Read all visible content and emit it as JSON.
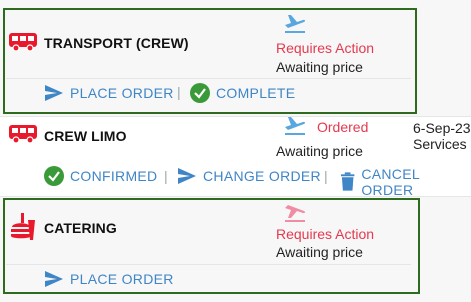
{
  "rows": [
    {
      "label": "TRANSPORT (CREW)",
      "status_primary": "Requires Action",
      "status_secondary": "Awaiting price",
      "actions": [
        "PLACE ORDER",
        "COMPLETE"
      ]
    },
    {
      "label": "CREW LIMO",
      "status_primary": "Ordered",
      "status_secondary": "Awaiting price",
      "date_text": "6-Sep-23",
      "vendor_text": "Services",
      "actions": [
        "CONFIRMED",
        "CHANGE ORDER",
        "CANCEL ORDER"
      ]
    },
    {
      "label": "CATERING",
      "status_primary": "Requires Action",
      "status_secondary": "Awaiting price",
      "actions": [
        "PLACE ORDER"
      ]
    }
  ],
  "separator": "|",
  "colors": {
    "action_blue": "#3f86c7",
    "status_red": "#e53950",
    "confirm_green": "#3a9a3a",
    "highlight_border": "#2f6b1f",
    "plane_blue": "#5aa7e0",
    "plane_pink": "#f08ca3",
    "icon_red": "#e8192c"
  }
}
